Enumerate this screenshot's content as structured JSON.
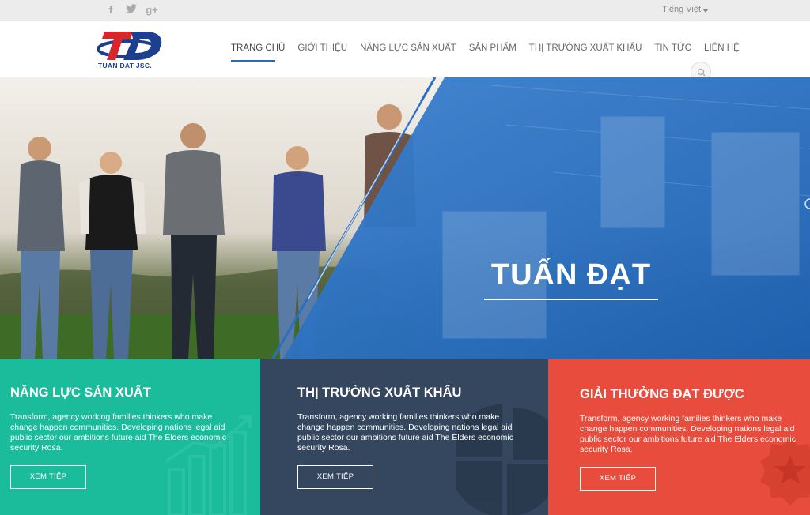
{
  "topbar": {
    "social": [
      {
        "icon": "facebook-icon",
        "glyph": "f"
      },
      {
        "icon": "twitter-icon",
        "glyph": "🐦"
      },
      {
        "icon": "google-plus-icon",
        "glyph": "g+"
      }
    ],
    "language": "Tiếng Việt"
  },
  "logo": {
    "name": "TUAN DAT JSC."
  },
  "nav": {
    "items": [
      "TRANG CHỦ",
      "GIỚI THIỆU",
      "NĂNG LỰC SẢN XUẤT",
      "SẢN PHẨM",
      "THỊ TRƯỜNG XUẤT KHẨU",
      "TIN TỨC",
      "LIÊN HỆ"
    ]
  },
  "hero": {
    "title": "TUẤN ĐẠT"
  },
  "panels": [
    {
      "title": "NĂNG LỰC SẢN XUẤT",
      "text": "Transform, agency working families thinkers who make change happen communities. Developing nations legal aid public sector our ambitions future aid The Elders economic security Rosa.",
      "button": "XEM TIẾP",
      "color": "#1bbc9b",
      "icon": "bar-chart-icon"
    },
    {
      "title": "THỊ TRƯỜNG XUẤT KHẨU",
      "text": "Transform, agency working families thinkers who make change happen communities. Developing nations legal aid public sector our ambitions future aid The Elders economic security Rosa.",
      "button": "XEM TIẾP",
      "color": "#34475e",
      "icon": "pie-chart-icon"
    },
    {
      "title": "GIẢI THƯỞNG ĐẠT ĐƯỢC",
      "text": "Transform, agency working families thinkers who make change happen communities. Developing nations legal aid public sector our ambitions future aid The Elders economic security Rosa.",
      "button": "XEM TIẾP",
      "color": "#e74c3c",
      "icon": "award-badge-icon"
    }
  ]
}
